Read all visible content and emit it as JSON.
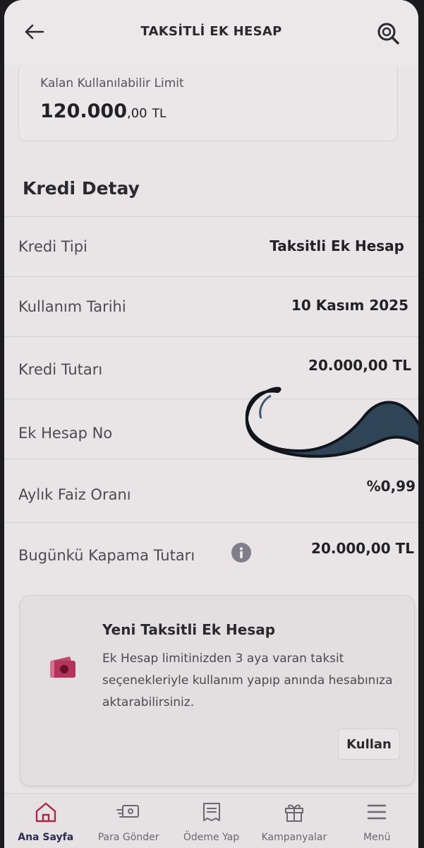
{
  "header": {
    "title": "TAKSİTLİ EK HESAP",
    "back_icon": "arrow-left-icon",
    "search_icon": "search-icon"
  },
  "limit": {
    "label": "Kalan Kullanılabilir Limit",
    "amount_main": "120.000",
    "amount_decimal": ",00",
    "currency": "TL"
  },
  "detail": {
    "title": "Kredi Detay",
    "rows": [
      {
        "label": "Kredi Tipi",
        "value": "Taksitli Ek Hesap"
      },
      {
        "label": "Kullanım Tarihi",
        "value": "10 Kasım 2025"
      },
      {
        "label": "Kredi Tutarı",
        "value": "20.000,00 TL"
      },
      {
        "label": "Ek Hesap No",
        "value": ""
      },
      {
        "label": "Aylık Faiz Oranı",
        "value": "%0,99"
      },
      {
        "label": "Bugünkü Kapama Tutarı",
        "value": "20.000,00 TL"
      }
    ]
  },
  "promo": {
    "title": "Yeni Taksitli Ek Hesap",
    "text": "Ek Hesap limitinizden 3 aya varan taksit seçenekleriyle kullanım yapıp anında hesabınıza aktarabilirsiniz.",
    "button_label": "Kullan"
  },
  "nav": {
    "items": [
      {
        "label": "Ana Sayfa",
        "icon": "home-icon",
        "active": true
      },
      {
        "label": "Para Gönder",
        "icon": "send-money-icon",
        "active": false
      },
      {
        "label": "Ödeme Yap",
        "icon": "payment-icon",
        "active": false
      },
      {
        "label": "Kampanyalar",
        "icon": "gift-icon",
        "active": false
      },
      {
        "label": "Menü",
        "icon": "menu-icon",
        "active": false
      }
    ]
  },
  "colors": {
    "background": "#e9e4e6",
    "text_dark": "#222226",
    "text_muted": "#4d4b52",
    "accent_brand": "#b2345c",
    "nav_active": "#2e2b52"
  }
}
